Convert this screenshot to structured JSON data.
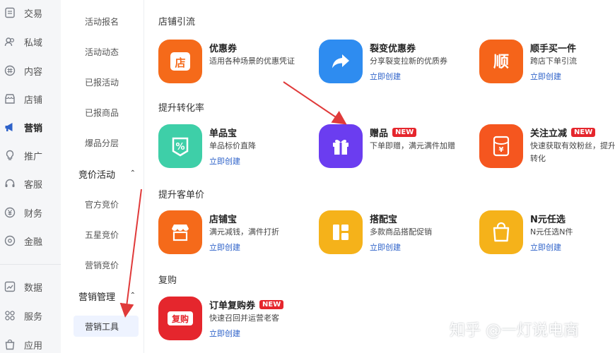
{
  "primary_nav": {
    "items": [
      {
        "label": "交易",
        "icon": "trade-icon"
      },
      {
        "label": "私域",
        "icon": "users-icon"
      },
      {
        "label": "内容",
        "icon": "hash-icon"
      },
      {
        "label": "店铺",
        "icon": "store-icon"
      },
      {
        "label": "营销",
        "icon": "megaphone-icon",
        "active": true
      },
      {
        "label": "推广",
        "icon": "bulb-icon"
      },
      {
        "label": "客服",
        "icon": "headset-icon"
      },
      {
        "label": "财务",
        "icon": "yen-icon"
      },
      {
        "label": "金融",
        "icon": "circle-icon"
      },
      {
        "label": "数据",
        "icon": "chart-icon"
      },
      {
        "label": "服务",
        "icon": "grid-icon"
      },
      {
        "label": "应用",
        "icon": "bag-icon"
      }
    ]
  },
  "secondary_nav": {
    "activity_items": [
      "活动报名",
      "活动动态",
      "已报活动",
      "已报商品",
      "爆品分层"
    ],
    "bidding_group": "竞价活动",
    "bidding_items": [
      "官方竞价",
      "五星竞价",
      "营销竞价"
    ],
    "manage_group": "营销管理",
    "manage_items": [
      "营销工具"
    ]
  },
  "sections": [
    {
      "title": "店铺引流",
      "cards": [
        {
          "name": "优惠券",
          "desc": "适用各种场景的优惠凭证",
          "link": "",
          "color": "#f56a1a",
          "glyph": "店"
        },
        {
          "name": "裂变优惠券",
          "desc": "分享裂变拉新的优质券",
          "link": "立即创建",
          "color": "#2e8cf0",
          "glyph": ""
        },
        {
          "name": "顺手买一件",
          "desc": "跨店下单引流",
          "link": "立即创建",
          "color": "#f5641a",
          "glyph": "顺"
        }
      ]
    },
    {
      "title": "提升转化率",
      "cards": [
        {
          "name": "单品宝",
          "desc": "单品标价直降",
          "link": "立即创建",
          "color": "#3ecfa8",
          "glyph": "%"
        },
        {
          "name": "赠品",
          "badge": "NEW",
          "desc": "下单即赠，满元满件加赠",
          "link": "",
          "color": "#6b3df0",
          "glyph": ""
        },
        {
          "name": "关注立减",
          "badge": "NEW",
          "desc": "快速获取有效粉丝，提升下单转化",
          "link": "",
          "color": "#f5561f",
          "glyph": "¥"
        }
      ]
    },
    {
      "title": "提升客单价",
      "cards": [
        {
          "name": "店铺宝",
          "desc": "满元减钱，满件打折",
          "link": "立即创建",
          "color": "#f56a1a",
          "glyph": ""
        },
        {
          "name": "搭配宝",
          "desc": "多款商品搭配促销",
          "link": "立即创建",
          "color": "#f5b21a",
          "glyph": ""
        },
        {
          "name": "N元任选",
          "desc": "N元任选N件",
          "link": "立即创建",
          "color": "#f5b21a",
          "glyph": ""
        }
      ]
    },
    {
      "title": "复购",
      "cards": [
        {
          "name": "订单复购券",
          "badge": "NEW",
          "desc": "快速召回并运营老客",
          "link": "立即创建",
          "color": "#e5262d",
          "glyph": "复购"
        }
      ]
    }
  ],
  "watermark": "知乎 @一灯说电商",
  "colors": {
    "link": "#2e62c9",
    "badge": "#e5262d",
    "arrow": "#e03a3a",
    "active_bg": "#eef3ff"
  }
}
